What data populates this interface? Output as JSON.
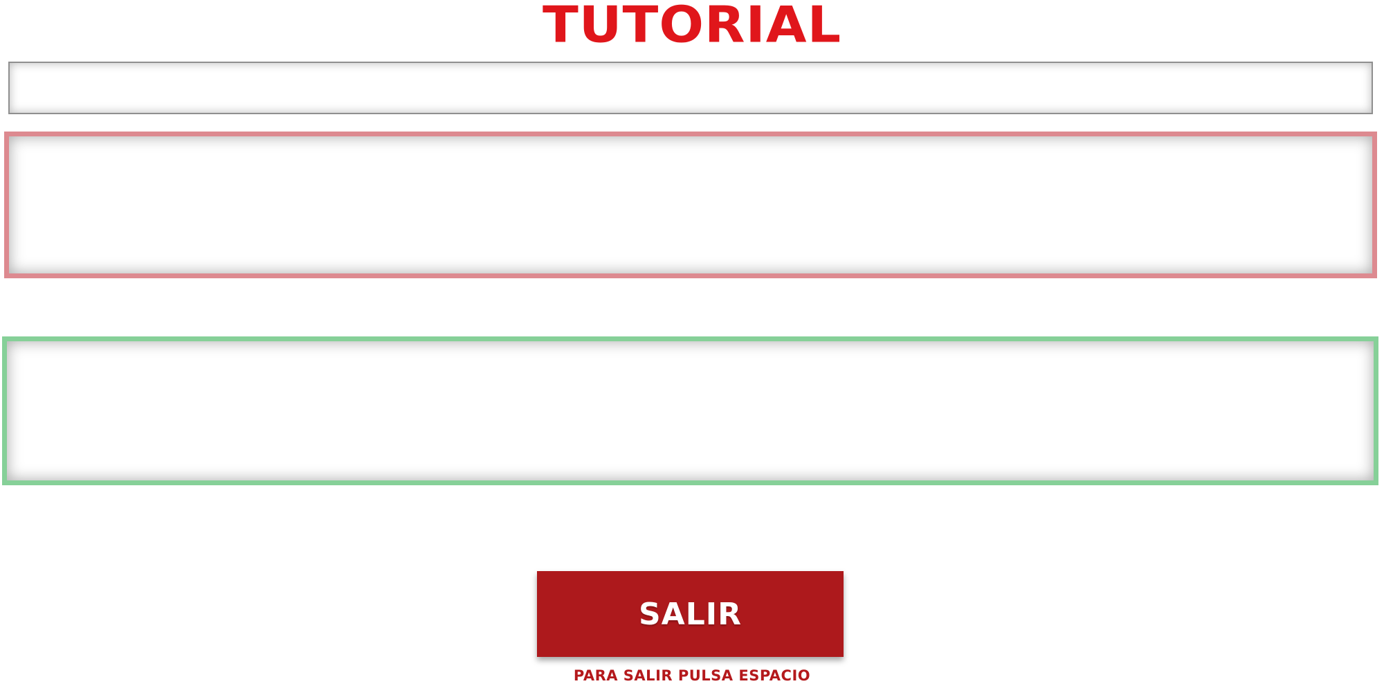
{
  "header": {
    "title": "TUTORIAL"
  },
  "actions": {
    "exit_label": "SALIR"
  },
  "footer": {
    "hint": "PARA SALIR PULSA ESPACIO"
  },
  "colors": {
    "title": "#e0161b",
    "red_panel_border": "#dd8a90",
    "green_panel_border": "#86d098",
    "button_background": "#ad191c",
    "hint": "#b4191c"
  }
}
